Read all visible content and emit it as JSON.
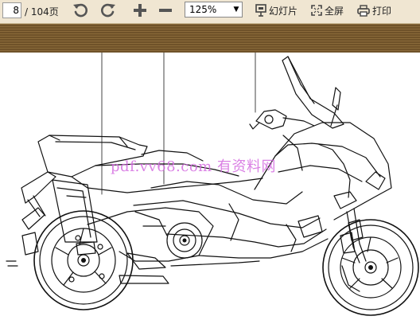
{
  "toolbar": {
    "page_current": "8",
    "page_total": "/ 104页",
    "zoom_value": "125%",
    "slideshow_label": "幻灯片",
    "fullscreen_label": "全屏",
    "print_label": "打印"
  },
  "icons": {
    "rotate_left": "rotate-left-icon",
    "rotate_right": "rotate-right-icon",
    "zoom_in": "plus-icon",
    "zoom_out": "minus-icon",
    "slideshow": "slideshow-icon",
    "fullscreen": "fullscreen-icon",
    "print": "printer-icon"
  },
  "document": {
    "watermark": "pdf.vv68.com 有资料网"
  },
  "colors": {
    "toolbar_bg": "#f0e6d2",
    "header_band": "#7a5c30",
    "watermark": "#d46be0"
  }
}
